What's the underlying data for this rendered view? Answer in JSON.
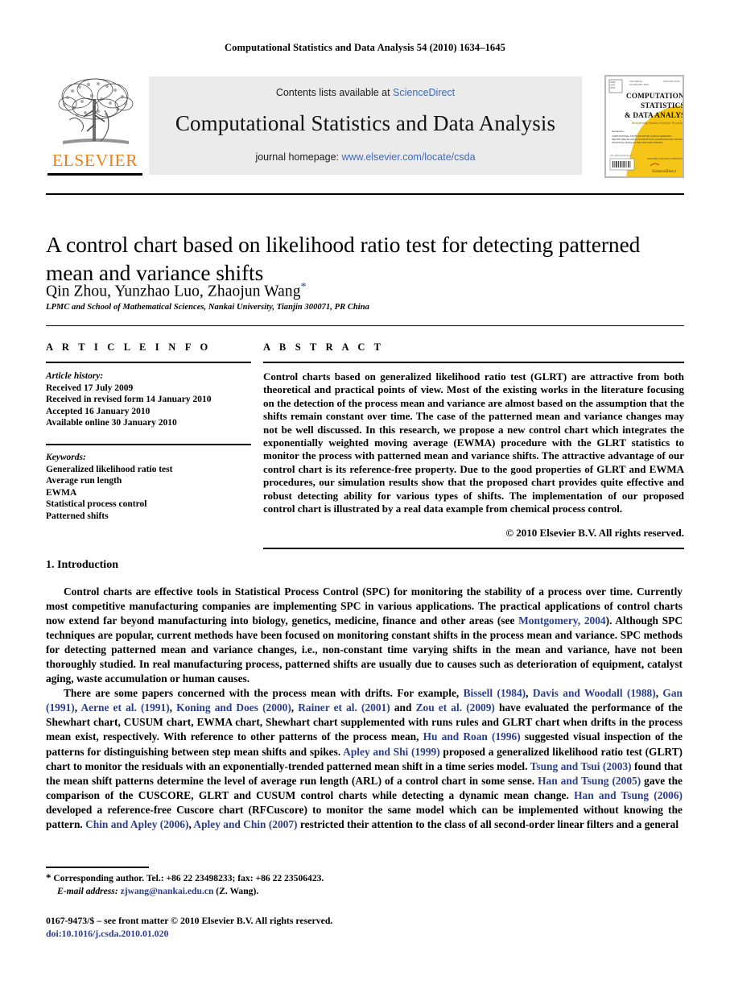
{
  "running_head": "Computational Statistics and Data Analysis 54 (2010) 1634–1645",
  "masthead": {
    "publisher_name": "ELSEVIER",
    "contents_prefix": "Contents lists available at ",
    "contents_link": "ScienceDirect",
    "journal_name": "Computational Statistics and Data Analysis",
    "homepage_prefix": "journal homepage: ",
    "homepage_url": "www.elsevier.com/locate/csda",
    "cover": {
      "line1": "COMPUTATIONAL",
      "line2": "STATISTICS",
      "line3": "& DATA ANALYSIS",
      "line4": "Incorporating Statistical Software Newsletter",
      "sciencedirect": "ScienceDirect"
    }
  },
  "article": {
    "title": "A control chart based on likelihood ratio test for detecting patterned mean and variance shifts",
    "authors": "Qin Zhou, Yunzhao Luo, Zhaojun Wang",
    "author_star": "*",
    "affiliation": "LPMC and School of Mathematical Sciences, Nankai University, Tianjin 300071, PR China"
  },
  "info": {
    "label": "A R T I C L E   I N F O",
    "history_label": "Article history:",
    "history": [
      "Received 17 July 2009",
      "Received in revised form 14 January 2010",
      "Accepted 16 January 2010",
      "Available online 30 January 2010"
    ],
    "keywords_label": "Keywords:",
    "keywords": [
      "Generalized likelihood ratio test",
      "Average run length",
      "EWMA",
      "Statistical process control",
      "Patterned shifts"
    ]
  },
  "abstract": {
    "label": "A B S T R A C T",
    "text": "Control charts based on generalized likelihood ratio test (GLRT) are attractive from both theoretical and practical points of view. Most of the existing works in the literature focusing on the detection of the process mean and variance are almost based on the assumption that the shifts remain constant over time. The case of the patterned mean and variance changes may not be well discussed. In this research, we propose a new control chart which integrates the exponentially weighted moving average (EWMA) procedure with the GLRT statistics to monitor the process with patterned mean and variance shifts. The attractive advantage of our control chart is its reference-free property. Due to the good properties of GLRT and EWMA procedures, our simulation results show that the proposed chart provides quite effective and robust detecting ability for various types of shifts. The implementation of our proposed control chart is illustrated by a real data example from chemical process control.",
    "copyright": "© 2010 Elsevier B.V. All rights reserved."
  },
  "body": {
    "section_number": "1.",
    "section_title": "Introduction",
    "paragraph1": {
      "part1": "Control charts are effective tools in Statistical Process Control (SPC) for monitoring the stability of a process over time. Currently most competitive manufacturing companies are implementing SPC in various applications. The practical applications of control charts now extend far beyond manufacturing into biology, genetics, medicine, finance and other areas (see ",
      "cite1": "Montgomery, 2004",
      "part2": "). Although SPC techniques are popular, current methods have been focused on monitoring constant shifts in the process mean and variance. SPC methods for detecting patterned mean and variance changes, i.e., non-constant time varying shifts in the mean and variance, have not been thoroughly studied. In real manufacturing process, patterned shifts are usually due to causes such as deterioration of equipment, catalyst aging, waste accumulation or human causes."
    },
    "paragraph2": {
      "t1": "There are some papers concerned with the process mean with drifts. For example, ",
      "c1": "Bissell (1984)",
      "t2": ", ",
      "c2": "Davis and Woodall (1988)",
      "t3": ", ",
      "c3": "Gan (1991)",
      "t4": ", ",
      "c4": "Aerne et al. (1991)",
      "t5": ", ",
      "c5": "Koning and Does (2000)",
      "t6": ", ",
      "c6": "Rainer et al. (2001)",
      "t7": " and ",
      "c7": "Zou et al. (2009)",
      "t8": " have evaluated the performance of the Shewhart chart, CUSUM chart, EWMA chart, Shewhart chart supplemented with runs rules and GLRT chart when drifts in the process mean exist, respectively. With reference to other patterns of the process mean, ",
      "c8": "Hu and Roan (1996)",
      "t9": " suggested visual inspection of the patterns for distinguishing between step mean shifts and spikes. ",
      "c9": "Apley and Shi (1999)",
      "t10": " proposed a generalized likelihood ratio test (GLRT) chart to monitor the residuals with an exponentially-trended patterned mean shift in a time series model. ",
      "c10": "Tsung and Tsui (2003)",
      "t11": " found that the mean shift patterns determine the level of average run length (ARL) of a control chart in some sense. ",
      "c11": "Han and Tsung (2005)",
      "t12": " gave the comparison of the CUSCORE, GLRT and CUSUM control charts while detecting a dynamic mean change. ",
      "c12": "Han and Tsung (2006)",
      "t13": " developed a reference-free Cuscore chart (RFCuscore) to monitor the same model which can be implemented without knowing the pattern. ",
      "c13": "Chin and Apley (2006)",
      "t14": ", ",
      "c14": "Apley and Chin (2007)",
      "t15": " restricted their attention to the class of all second-order linear filters and a general"
    }
  },
  "footnotes": {
    "star": "*",
    "corresponding": "Corresponding author. Tel.: +86 22 23498233; fax: +86 22 23506423.",
    "email_label": "E-mail address:",
    "email": "zjwang@nankai.edu.cn",
    "email_suffix": "(Z. Wang).",
    "front_matter": "0167-9473/$ – see front matter © 2010 Elsevier B.V. All rights reserved.",
    "doi": "doi:10.1016/j.csda.2010.01.020"
  },
  "colors": {
    "link_blue": "#4169b2",
    "cite_blue": "#2b3e8c",
    "elsevier_orange": "#f07f1a",
    "panel_grey": "#ebebeb",
    "cover_yellow": "#f5c518"
  }
}
